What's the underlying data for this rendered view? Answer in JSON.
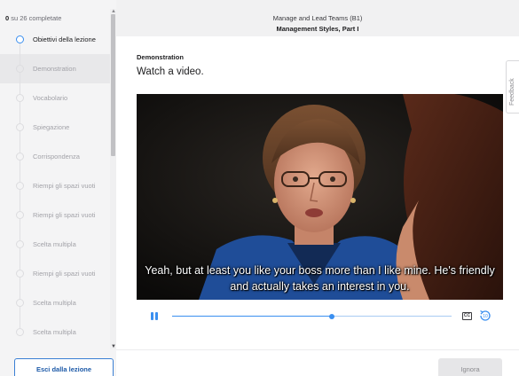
{
  "sidebar": {
    "progress_done": "0",
    "progress_rest": " su 26 completate",
    "items": [
      {
        "label": "Obiettivi della lezione",
        "state": "current"
      },
      {
        "label": "Demonstration",
        "state": "active"
      },
      {
        "label": "Vocabolario",
        "state": "pending"
      },
      {
        "label": "Spiegazione",
        "state": "pending"
      },
      {
        "label": "Corrispondenza",
        "state": "pending"
      },
      {
        "label": "Riempi gli spazi vuoti",
        "state": "pending"
      },
      {
        "label": "Riempi gli spazi vuoti",
        "state": "pending"
      },
      {
        "label": "Scelta multipla",
        "state": "pending"
      },
      {
        "label": "Riempi gli spazi vuoti",
        "state": "pending"
      },
      {
        "label": "Scelta multipla",
        "state": "pending"
      },
      {
        "label": "Scelta multipla",
        "state": "pending"
      }
    ],
    "exit_label": "Esci dalla lezione"
  },
  "header": {
    "course_title": "Manage and Lead Teams (B1)",
    "lesson_title": "Management Styles, Part I"
  },
  "main": {
    "section_label": "Demonstration",
    "instruction": "Watch a video.",
    "feedback_label": "Feedback"
  },
  "video": {
    "subtitle_line1": "Yeah, but at least you like your boss more than I like mine. He's friendly",
    "subtitle_line2": "and actually takes an interest in you.",
    "playback_progress": 0.57,
    "state": "playing",
    "cc_label": "CC",
    "replay_label": "10"
  },
  "footer": {
    "ignore_label": "Ignora"
  },
  "colors": {
    "accent": "#3a8ff0",
    "exit_border": "#3a7fd4",
    "sidebar_bg": "#f4f4f5",
    "header_bg": "#f1f1f2"
  }
}
